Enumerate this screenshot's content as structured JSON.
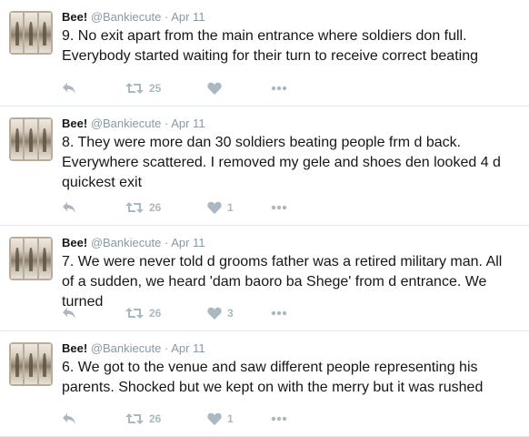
{
  "tweets": [
    {
      "name": "Bee!",
      "handle": "@Bankiecute",
      "separator": "·",
      "time": "Apr 11",
      "text": "9. No exit apart from the main entrance where soldiers don full. Everybody started waiting for their turn to receive correct beating",
      "retweets": "25",
      "likes": ""
    },
    {
      "name": "Bee!",
      "handle": "@Bankiecute",
      "separator": "·",
      "time": "Apr 11",
      "text": "8. They were more dan 30 soldiers beating people frm d back. Everywhere scattered. I removed my gele and shoes den looked 4 d quickest exit",
      "retweets": "26",
      "likes": "1"
    },
    {
      "name": "Bee!",
      "handle": "@Bankiecute",
      "separator": "·",
      "time": "Apr 11",
      "text": "7. We were never told d grooms father was a retired military man. All of a sudden, we heard 'dam baoro ba Shege' from d entrance. We turned",
      "retweets": "26",
      "likes": "3"
    },
    {
      "name": "Bee!",
      "handle": "@Bankiecute",
      "separator": "·",
      "time": "Apr 11",
      "text": "6. We got to the venue and saw different people representing his parents. Shocked but we kept on with the merry but it was rushed",
      "retweets": "26",
      "likes": "1"
    }
  ],
  "icons": {
    "reply": "reply-icon",
    "retweet": "retweet-icon",
    "like": "heart-icon",
    "more": "more-icon"
  },
  "colors": {
    "text": "#14171a",
    "muted": "#8899a6",
    "icon": "#aab8c2",
    "divider": "#e1e8ed"
  }
}
